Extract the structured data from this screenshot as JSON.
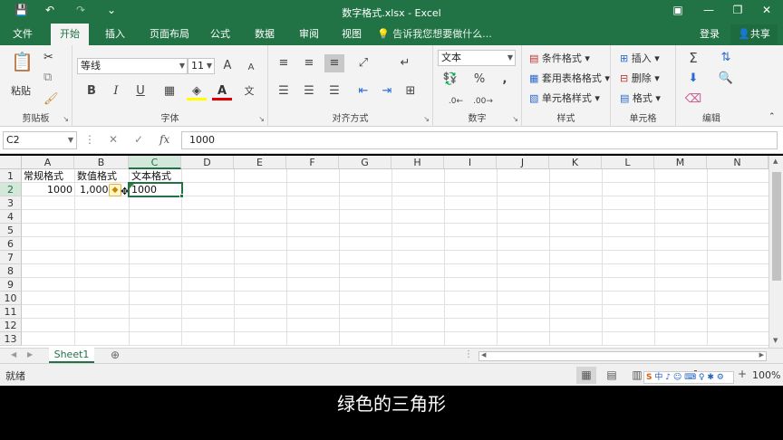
{
  "titlebar": {
    "title": "数字格式.xlsx - Excel",
    "qa_save": "💾",
    "qa_undo": "↶",
    "qa_redo": "↷",
    "qa_more": "⌄",
    "win_ribbon": "▣",
    "win_min": "—",
    "win_max": "❐",
    "win_close": "✕"
  },
  "tabs": [
    "文件",
    "开始",
    "插入",
    "页面布局",
    "公式",
    "数据",
    "审阅",
    "视图"
  ],
  "active_tab": "开始",
  "tellme": "告诉我您想要做什么...",
  "login": "登录",
  "share": "共享",
  "ribbon": {
    "clipboard": {
      "label": "剪贴板",
      "paste": "粘贴"
    },
    "font": {
      "label": "字体",
      "name": "等线",
      "size": "11",
      "bold": "B",
      "italic": "I",
      "underline": "U",
      "grow": "A",
      "shrink": "A",
      "phonetic": "文"
    },
    "alignment": {
      "label": "对齐方式"
    },
    "number": {
      "label": "数字",
      "format": "文本",
      "percent": "%",
      "comma": ","
    },
    "styles": {
      "label": "样式",
      "conditional": "条件格式",
      "table": "套用表格格式",
      "cell_styles": "单元格样式"
    },
    "cells": {
      "label": "单元格",
      "insert": "插入",
      "delete": "删除",
      "format": "格式"
    },
    "editing": {
      "label": "编辑"
    }
  },
  "formula_bar": {
    "namebox": "C2",
    "cancel": "✕",
    "enter": "✓",
    "fx": "fx",
    "value": "1000"
  },
  "grid": {
    "columns": [
      "A",
      "B",
      "C",
      "D",
      "E",
      "F",
      "G",
      "H",
      "I",
      "J",
      "K",
      "L",
      "M",
      "N"
    ],
    "rows": [
      "1",
      "2",
      "3",
      "4",
      "5",
      "6",
      "7",
      "8",
      "9",
      "10",
      "11",
      "12",
      "13"
    ],
    "selected_column": "C",
    "selected_row": "2",
    "cells": {
      "A1": "常规格式",
      "B1": "数值格式",
      "C1": "文本格式",
      "A2": "1000",
      "B2": "1,000.",
      "C2": "1000"
    }
  },
  "sheets": [
    "Sheet1"
  ],
  "status": {
    "text": "就绪",
    "zoom": "100%",
    "ime": "中 ♪ ☺ ⌨ ♀ ✱ ⚙"
  },
  "subtitle": "绿色的三角形",
  "colors": {
    "accent": "#217346",
    "triangle": "#1e8a3a"
  }
}
